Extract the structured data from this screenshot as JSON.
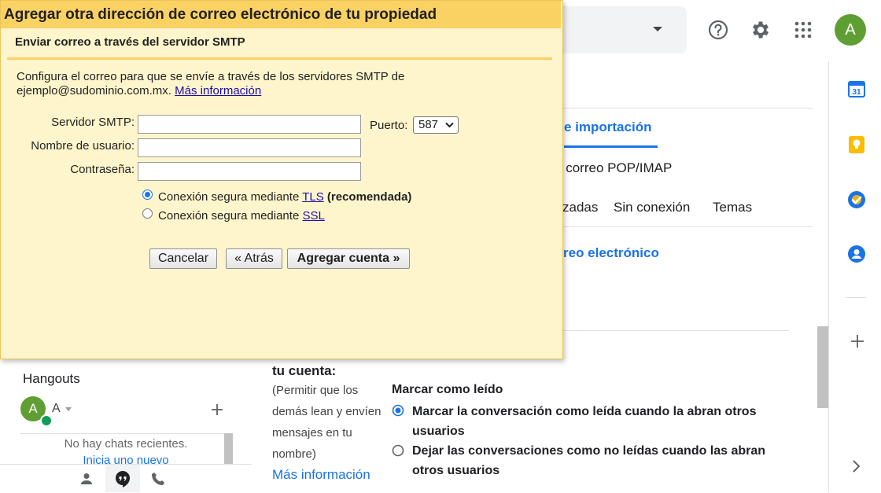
{
  "header": {
    "avatar_letter": "A",
    "help_icon": "help-circle-icon",
    "settings_icon": "gear-icon",
    "apps_icon": "apps-grid-icon"
  },
  "settings": {
    "tab_active": "e importación",
    "row_pop_imap": "y correo POP/IMAP",
    "row_tabs": [
      "zadas",
      "Sin conexión",
      "Temas"
    ],
    "row_email": "reo electrónico",
    "tu_cuenta": "tu cuenta:",
    "permit_lines": [
      "(Permitir que los",
      "demás lean y envíen",
      "mensajes en tu",
      "nombre)"
    ],
    "mas_info": "Más información",
    "marcar_title": "Marcar como leído",
    "option1": "Marcar la conversación como leída cuando la abran otros usuarios",
    "option2": "Dejar las conversaciones como no leídas cuando las abran otros usuarios"
  },
  "hangouts": {
    "title": "Hangouts",
    "user_letter": "A",
    "user_name": "A",
    "no_chats": "No hay chats recientes.",
    "start_new": "Inicia uno nuevo"
  },
  "dialog": {
    "title": "Agregar otra dirección de correo electrónico de tu propiedad",
    "subtitle": "Enviar correo a través del servidor SMTP",
    "desc": "Configura el correo para que se envíe a través de los servidores SMTP de ejemplo@sudominio.com.mx.",
    "desc_link": "Más información",
    "smtp_label": "Servidor SMTP:",
    "smtp_value": "",
    "port_label": "Puerto:",
    "port_value": "587",
    "user_label": "Nombre de usuario:",
    "user_value": "",
    "pass_label": "Contraseña:",
    "pass_value": "",
    "tls_text": "Conexión segura mediante",
    "tls_link": "TLS",
    "tls_suffix": "(recomendada)",
    "ssl_text": "Conexión segura mediante",
    "ssl_link": "SSL",
    "cancel": "Cancelar",
    "back": "« Atrás",
    "add": "Agregar cuenta »"
  },
  "colors": {
    "dialog_title_bg": "#fad163",
    "dialog_bg": "#fff5cc",
    "accent_blue": "#1a73e8",
    "avatar_green": "#5f9e32"
  }
}
